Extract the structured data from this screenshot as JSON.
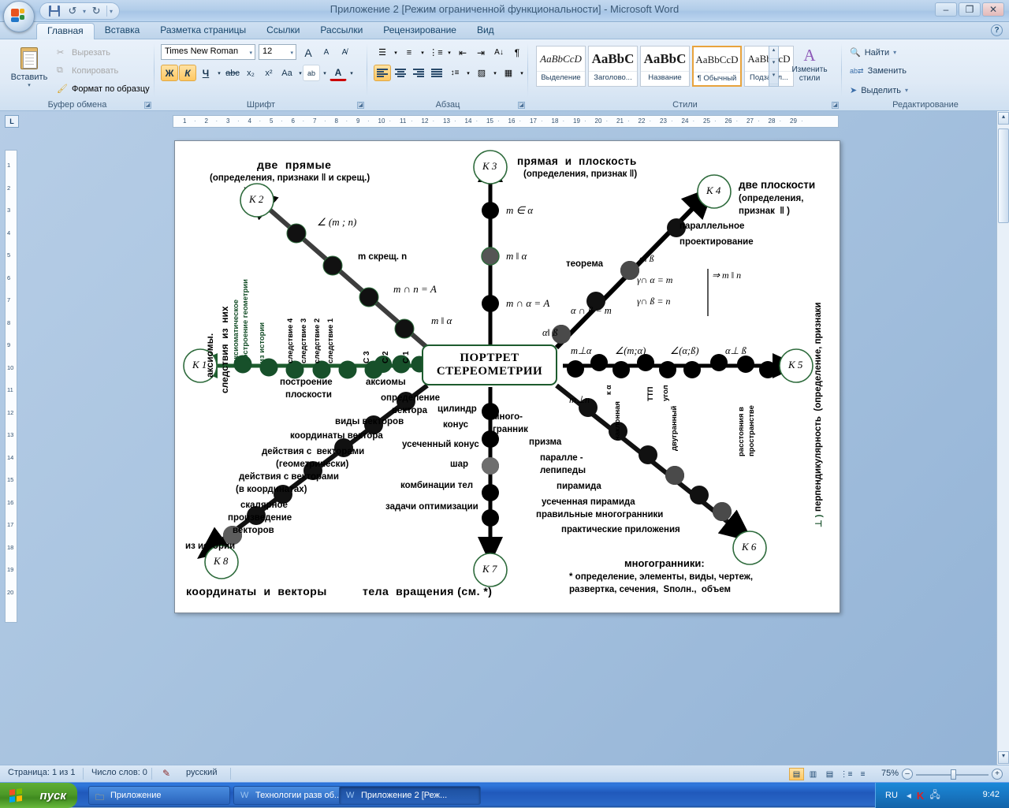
{
  "window": {
    "title": "Приложение 2 [Режим ограниченной функциональности] - Microsoft Word",
    "minimize": "–",
    "restore": "❐",
    "close": "✕",
    "help": "?"
  },
  "qat": {
    "save": "save-icon",
    "undo": "↺",
    "undo_arrow": "▾",
    "redo": "↻",
    "more": "▾"
  },
  "tabs": [
    {
      "label": "Главная",
      "active": true
    },
    {
      "label": "Вставка",
      "active": false
    },
    {
      "label": "Разметка страницы",
      "active": false
    },
    {
      "label": "Ссылки",
      "active": false
    },
    {
      "label": "Рассылки",
      "active": false
    },
    {
      "label": "Рецензирование",
      "active": false
    },
    {
      "label": "Вид",
      "active": false
    }
  ],
  "ribbon": {
    "clipboard": {
      "group_label": "Буфер обмена",
      "paste": "Вставить",
      "cut": "Вырезать",
      "copy": "Копировать",
      "format_painter": "Формат по образцу"
    },
    "font": {
      "group_label": "Шрифт",
      "font_name": "Times New Roman",
      "font_size": "12",
      "grow": "A",
      "shrink": "A",
      "clear": "A̶",
      "bold": "Ж",
      "italic": "К",
      "underline": "Ч",
      "strike": "abc",
      "subscript": "x₂",
      "superscript": "x²",
      "case": "Aa",
      "highlight": "ab",
      "color": "A"
    },
    "paragraph": {
      "group_label": "Абзац",
      "bullets": "•☰",
      "numbering": "1☰",
      "multilevel": "⁎☰",
      "dec_indent": "⇤",
      "inc_indent": "⇥",
      "sort": "A↓",
      "marks": "¶",
      "align_left": "left",
      "align_center": "center",
      "align_right": "right",
      "justify": "justify",
      "line_spacing": "↕☰",
      "shading": "▨",
      "borders": "▦"
    },
    "styles": {
      "group_label": "Стили",
      "items": [
        {
          "preview": "AaBbCcD",
          "name": "Выделение",
          "selected": false
        },
        {
          "preview": "AaBbC",
          "name": "Заголово...",
          "selected": false
        },
        {
          "preview": "AaBbC",
          "name": "Название",
          "selected": false
        },
        {
          "preview": "AaBbCcD",
          "name": "¶ Обычный",
          "selected": true
        },
        {
          "preview": "AaBbCcD",
          "name": "Подзагол...",
          "selected": false
        }
      ],
      "change_styles": "Изменить стили",
      "scroll_up": "▴",
      "scroll_down": "▾",
      "scroll_more": "▾"
    },
    "editing": {
      "group_label": "Редактирование",
      "find": "Найти",
      "replace": "Заменить",
      "select": "Выделить"
    }
  },
  "ruler": {
    "corner": "L",
    "h_numbers": [
      "1",
      "2",
      "3",
      "4",
      "5",
      "6",
      "7",
      "8",
      "9",
      "10",
      "11",
      "12",
      "13",
      "14",
      "15",
      "16",
      "17",
      "18",
      "19",
      "20",
      "21",
      "22",
      "23",
      "24",
      "25",
      "26",
      "27",
      "28",
      "29"
    ],
    "v_numbers": [
      "1",
      "2",
      "3",
      "4",
      "5",
      "6",
      "7",
      "8",
      "9",
      "10",
      "11",
      "12",
      "13",
      "14",
      "15",
      "16",
      "17",
      "18",
      "19",
      "20"
    ]
  },
  "statusbar": {
    "page": "Страница: 1 из 1",
    "words": "Число слов: 0",
    "language": "русский",
    "proof_icon": "proofing-icon",
    "views": [
      "print-layout-icon",
      "full-screen-reading-icon",
      "web-layout-icon",
      "outline-icon",
      "draft-icon"
    ],
    "zoom": "75%",
    "zoom_out": "–",
    "zoom_in": "+"
  },
  "taskbar": {
    "start": "пуск",
    "items": [
      {
        "label": "Приложение",
        "icon": "folder-icon",
        "active": false
      },
      {
        "label": "Технологии разв об...",
        "icon": "word-icon",
        "active": false
      },
      {
        "label": "Приложение 2 [Реж...",
        "icon": "word-icon",
        "active": true
      }
    ],
    "tray_lang": "RU",
    "tray_icons": [
      "show-desktop-icon",
      "kaspersky-icon",
      "network-icon"
    ],
    "clock": "9:42"
  },
  "diagram": {
    "center_line1": "ПОРТРЕТ",
    "center_line2": "СТЕРЕОМЕТРИИ",
    "nodes": {
      "k1": "К 1",
      "k2": "К 2",
      "k3": "К 3",
      "k4": "К 4",
      "k5": "К 5",
      "k6": "К 6",
      "k7": "К 7",
      "k8": "К 8"
    },
    "headings": {
      "two_lines_title": "две  прямые",
      "two_lines_sub": "(определения, признаки ‖ и скрещ.)",
      "line_plane_title": "прямая  и  плоскость",
      "line_plane_sub": "(определения, признак ‖)",
      "two_planes_title": "две плоскости",
      "two_planes_sub1": "(определения,",
      "two_planes_sub2": "признак  ‖ )",
      "axioms_v1": "аксиомы.",
      "axioms_v2": "следствия  из  них",
      "perp_v": "перпендикулярность  (определение, признаки",
      "perp_v_tail": "⊥ )",
      "coords_vectors": "координаты  и  векторы",
      "solids_rev": "тела  вращения (см. *)",
      "polyhedra_title": "многогранники:",
      "polyhedra_note1": "* определение, элементы, виды, чертеж,",
      "polyhedra_note2": "развертка, сечения,  Sполн.,  объем"
    },
    "axis_k1": {
      "labels_vertical": [
        "аксиоматическое\nпостроение геометрии",
        "из  истории",
        "следствие 4",
        "следствие 3",
        "следствие 2",
        "следствие 1",
        "С 3",
        "С 2",
        "С 1"
      ],
      "labels_below": [
        "построение\nплоскости",
        "аксиомы"
      ]
    },
    "axis_k2": [
      "∠ (m ; n)",
      "m скрещ. n",
      "m ∩ n = A",
      "m ‖ α"
    ],
    "axis_k3": [
      "m ∈ α",
      "m ‖ α",
      "m ∩ α = A"
    ],
    "axis_k4": [
      "параллельное\nпроектирование",
      "теорема",
      "α ∩ ß = m",
      "α‖ ß"
    ],
    "axis_k4_formula": [
      "α‖ ß",
      "γ∩ α = m",
      "γ∩ ß = n",
      "⇒ m ‖ n"
    ],
    "axis_k5_above": [
      "m⊥α",
      "∠(m;α)",
      "∠(α;ß)",
      "α⊥ ß"
    ],
    "axis_k5_below": [
      "m⊥n",
      "наклонная\nк α",
      "ТТП",
      "двугранный\nугол",
      "расстояния в\nпространстве"
    ],
    "axis_k6": [
      "много-\nгранник",
      "призма",
      "паралле -\nлепипеды",
      "пирамида",
      "усеченная пирамида",
      "правильные многогранники",
      "практические приложения"
    ],
    "axis_k7": [
      "цилиндр",
      "конус",
      "усеченный конус",
      "шар",
      "комбинации тел",
      "задачи оптимизации"
    ],
    "axis_k8": [
      "определение\nвектора",
      "виды векторов",
      "координаты вектора",
      "действия с  векторами\n(геометрически)",
      "действия с векторами\n(в координатах)",
      "скалярное\nпроизведение\nвекторов",
      "из истории"
    ]
  },
  "colors": {
    "green_axis": "#1d5c2e",
    "black_axis": "#000000",
    "node_ring": "#2e6b3c",
    "word_blue": "#1d3c5c"
  }
}
